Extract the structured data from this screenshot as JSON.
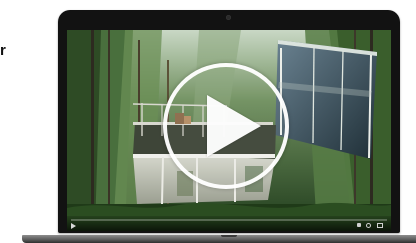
{
  "side_text": "r",
  "video": {
    "progress_fraction": 0.0
  },
  "icons": {
    "big_play": "play-icon",
    "small_play": "play-icon",
    "volume": "volume-icon",
    "settings": "gear-icon",
    "fullscreen": "fullscreen-icon",
    "camera": "camera-icon"
  },
  "colors": {
    "laptop_bezel": "#121212",
    "progress": "#c81a1a"
  }
}
